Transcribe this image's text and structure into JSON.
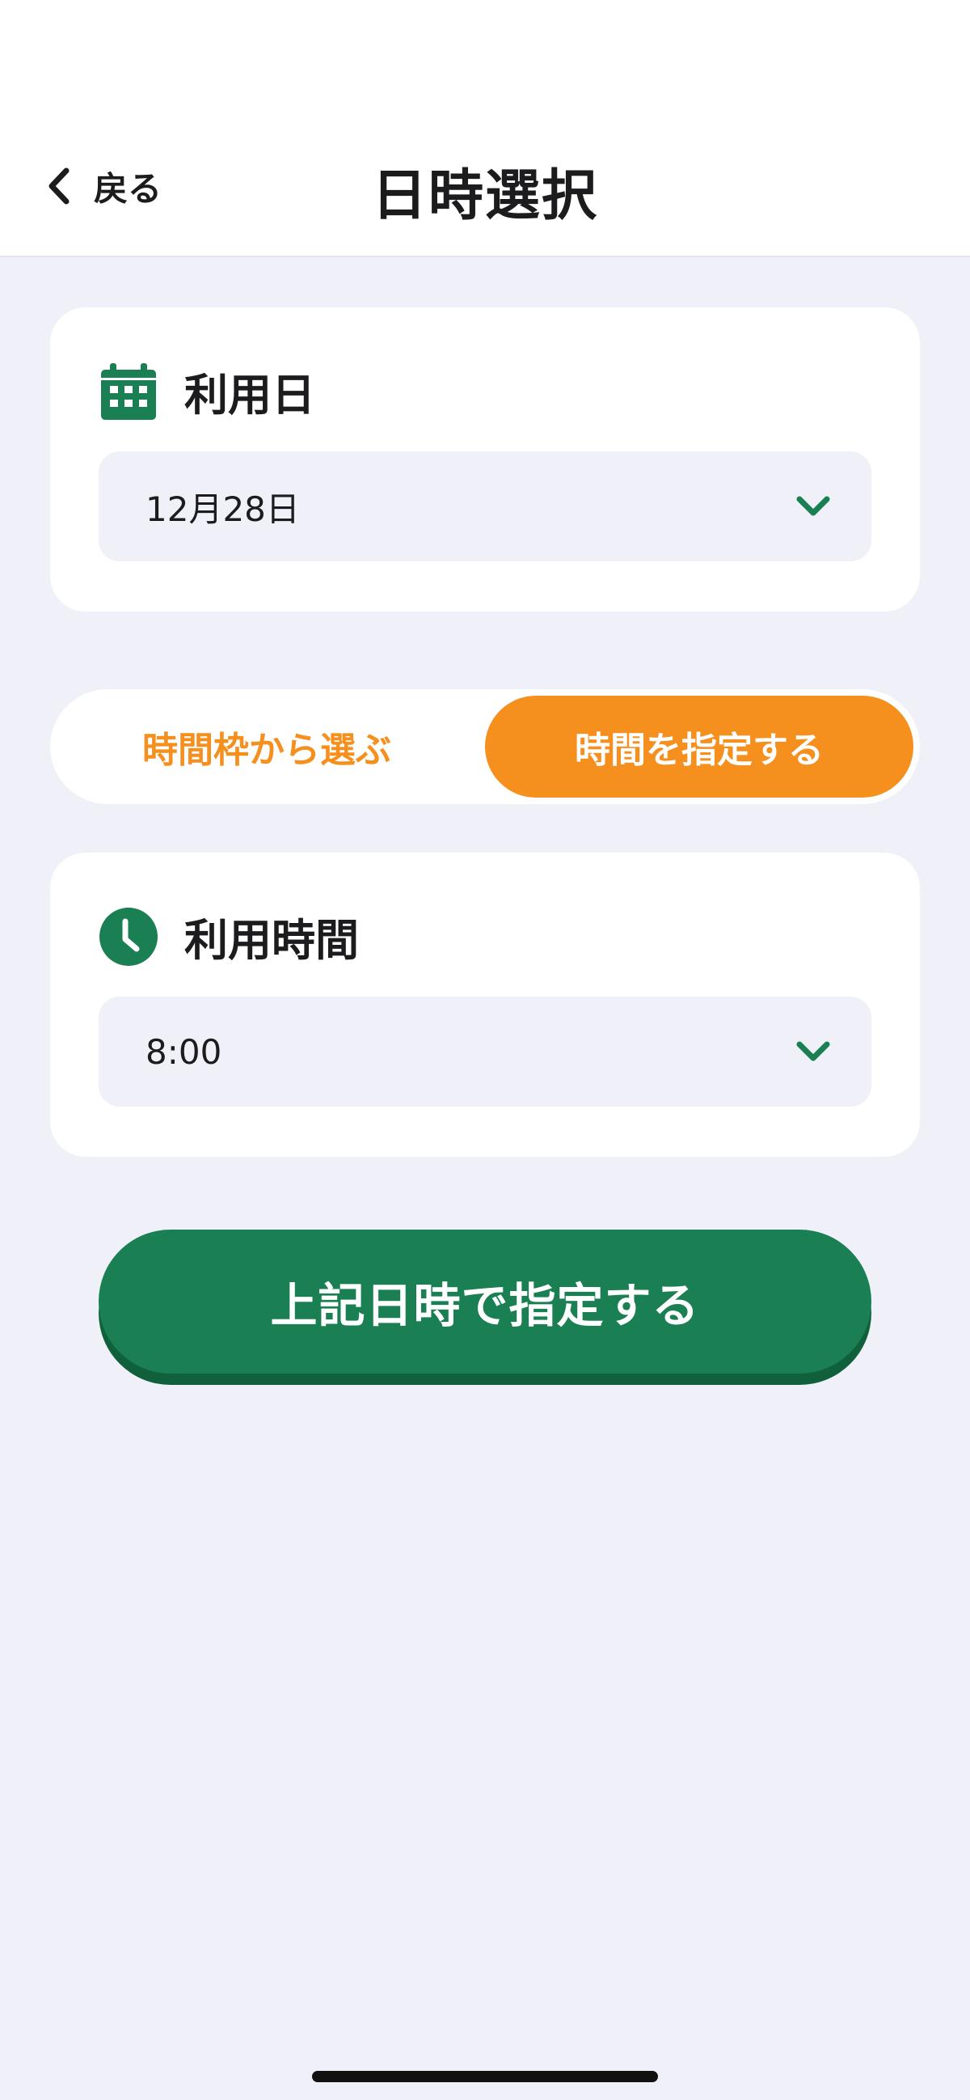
{
  "header": {
    "back_label": "戻る",
    "title": "日時選択"
  },
  "date_card": {
    "title": "利用日",
    "icon": "calendar-icon",
    "value": "12月28日"
  },
  "mode_toggle": {
    "options": [
      "時間枠から選ぶ",
      "時間を指定する"
    ],
    "selected": "時間を指定する"
  },
  "time_card": {
    "title": "利用時間",
    "icon": "clock-icon",
    "value": "8:00"
  },
  "submit": {
    "label": "上記日時で指定する"
  },
  "colors": {
    "accent_green": "#1a7f52",
    "accent_orange": "#f5901e",
    "background": "#eff0f8"
  }
}
